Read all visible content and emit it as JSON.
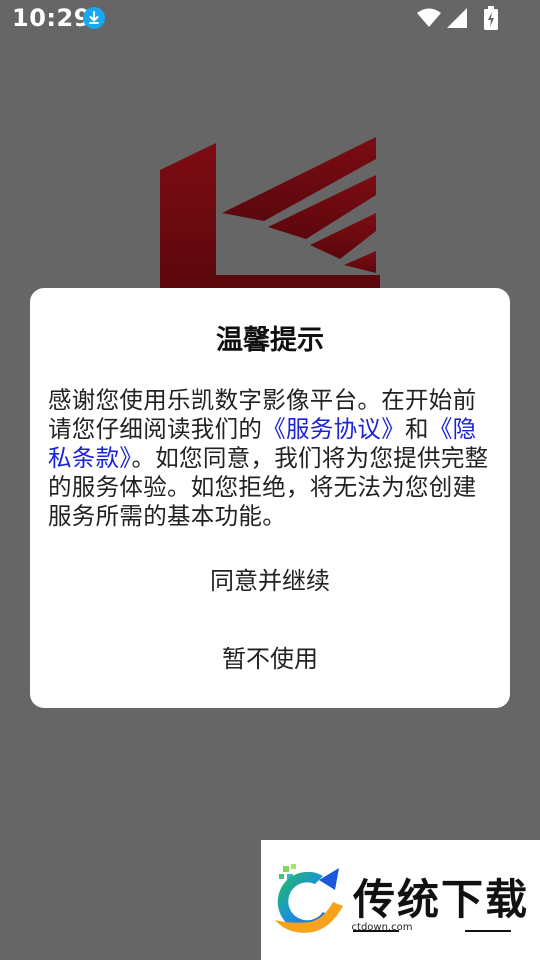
{
  "status_bar": {
    "time": "10:29",
    "icons": [
      "download-icon",
      "wifi-icon",
      "signal-icon",
      "battery-icon"
    ]
  },
  "background": {
    "logo": "brand-logo",
    "logo_color": "#7a0b12",
    "overlay_color": "#666666"
  },
  "dialog": {
    "title": "温馨提示",
    "body_part1": "感谢您使用乐凯数字影像平台。在开始前请您仔细阅读我们的",
    "service_link": "《服务协议》",
    "body_part2": "和",
    "privacy_link": "《隐私条款》",
    "body_part3": "。如您同意，我们将为您提供完整的服务体验。如您拒绝，将无法为您创建服务所需的基本功能。",
    "agree_label": "同意并继续",
    "decline_label": "暂不使用",
    "link_color": "#1a24d6"
  },
  "watermark": {
    "name": "传统下载",
    "url": "ctdown.com"
  }
}
